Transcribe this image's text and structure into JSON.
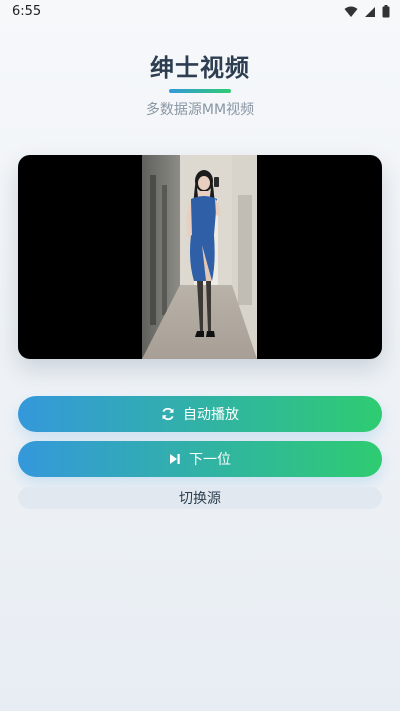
{
  "status": {
    "time": "6:55"
  },
  "header": {
    "title": "绅士视频",
    "subtitle": "多数据源MM视频"
  },
  "colors": {
    "accent_start": "#3498db",
    "accent_end": "#2ecc71",
    "title": "#2c3e50"
  },
  "controls": {
    "autoplay_label": "自动播放",
    "next_label": "下一位",
    "switch_source_label": "切换源"
  },
  "icons": {
    "autoplay": "refresh-icon",
    "next": "skip-next-icon"
  }
}
